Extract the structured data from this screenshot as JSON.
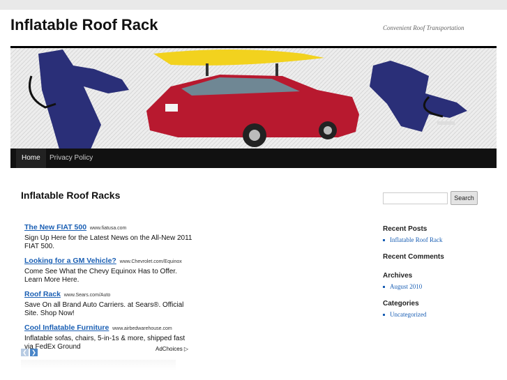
{
  "site": {
    "title": "Inflatable Roof Rack",
    "description": "Convenient Roof Transportation"
  },
  "nav": {
    "items": [
      {
        "label": "Home"
      },
      {
        "label": "Privacy Policy"
      }
    ]
  },
  "main": {
    "title": "Inflatable Roof Racks",
    "ads": [
      {
        "title": "The New FIAT 500",
        "url": "www.fiatusa.com",
        "text": "Sign Up Here for the Latest News on the All-New 2011 FIAT 500."
      },
      {
        "title": "Looking for a GM Vehicle?",
        "url": "www.Chevrolet.com/Equinox",
        "text": "Come See What the Chevy Equinox Has to Offer. Learn More Here."
      },
      {
        "title": "Roof Rack",
        "url": "www.Sears.com/Auto",
        "text": "Save On all Brand Auto Carriers. at Sears®. Official Site. Shop Now!"
      },
      {
        "title": "Cool Inflatable Furniture",
        "url": "www.airbedwarehouse.com",
        "text": "Inflatable sofas, chairs, 5-in-1s & more, shipped fast via FedEx Ground"
      }
    ],
    "adchoices": "AdChoices"
  },
  "sidebar": {
    "search_button": "Search",
    "recent_posts": {
      "title": "Recent Posts",
      "items": [
        "Inflatable Roof Rack"
      ]
    },
    "recent_comments": {
      "title": "Recent Comments"
    },
    "archives": {
      "title": "Archives",
      "items": [
        "August 2010"
      ]
    },
    "categories": {
      "title": "Categories",
      "items": [
        "Uncategorized"
      ]
    }
  },
  "colors": {
    "link": "#1a5fb4",
    "nav_bg": "#111111",
    "car": "#b8192f",
    "kayak": "#f2d21e",
    "bag": "#2a2f78"
  },
  "icons": [
    "prev-arrow-icon",
    "next-arrow-icon",
    "adchoices-icon",
    "header-image"
  ]
}
